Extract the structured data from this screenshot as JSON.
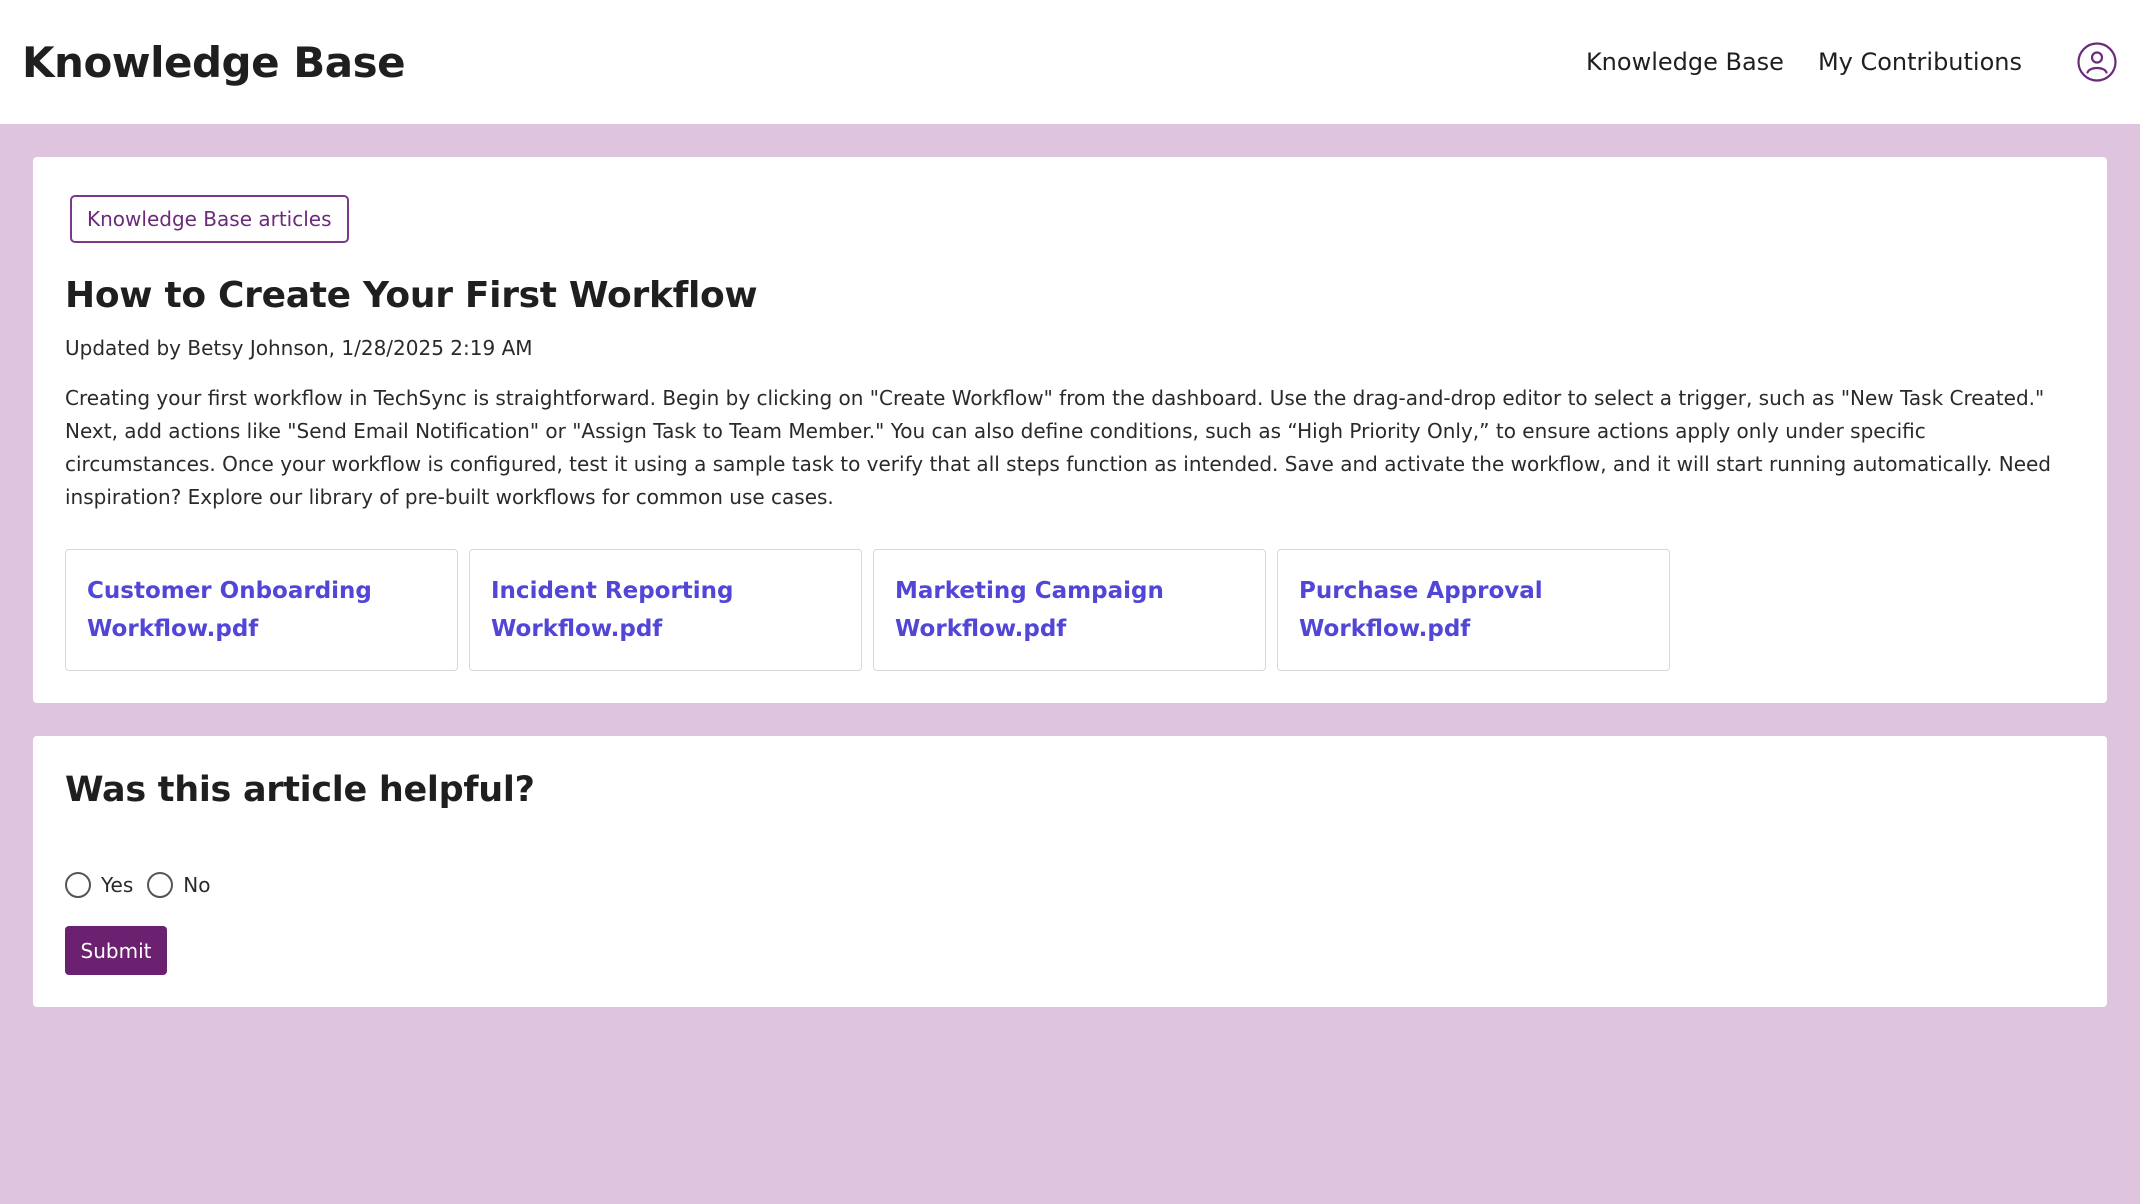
{
  "header": {
    "brand": "Knowledge Base",
    "nav": [
      {
        "label": "Knowledge Base"
      },
      {
        "label": "My Contributions"
      }
    ],
    "avatar_icon": "user-circle-icon"
  },
  "article": {
    "breadcrumb_chip": "Knowledge Base articles",
    "title": "How to Create Your First Workflow",
    "meta": "Updated by Betsy Johnson, 1/28/2025 2:19 AM",
    "body": "Creating your first workflow in TechSync is straightforward. Begin by clicking on \"Create Workflow\" from the dashboard. Use the drag-and-drop editor to select a trigger, such as \"New Task Created.\" Next, add actions like \"Send Email Notification\" or \"Assign Task to Team Member.\" You can also define conditions, such as “High Priority Only,” to ensure actions apply only under specific circumstances. Once your workflow is configured, test it using a sample task to verify that all steps function as intended. Save and activate the workflow, and it will start running automatically. Need inspiration? Explore our library of pre-built workflows for common use cases.",
    "attachments": [
      {
        "line1": "Customer Onboarding",
        "line2": "Workflow.pdf"
      },
      {
        "line1": "Incident Reporting",
        "line2": "Workflow.pdf"
      },
      {
        "line1": "Marketing Campaign",
        "line2": "Workflow.pdf"
      },
      {
        "line1": "Purchase Approval",
        "line2": "Workflow.pdf"
      }
    ]
  },
  "feedback": {
    "title": "Was this article helpful?",
    "options": [
      {
        "label": "Yes"
      },
      {
        "label": "No"
      }
    ],
    "submit_label": "Submit"
  },
  "colors": {
    "page_background": "#dfc4e0",
    "accent_purple": "#6b2170",
    "link_blue": "#5146d6"
  }
}
